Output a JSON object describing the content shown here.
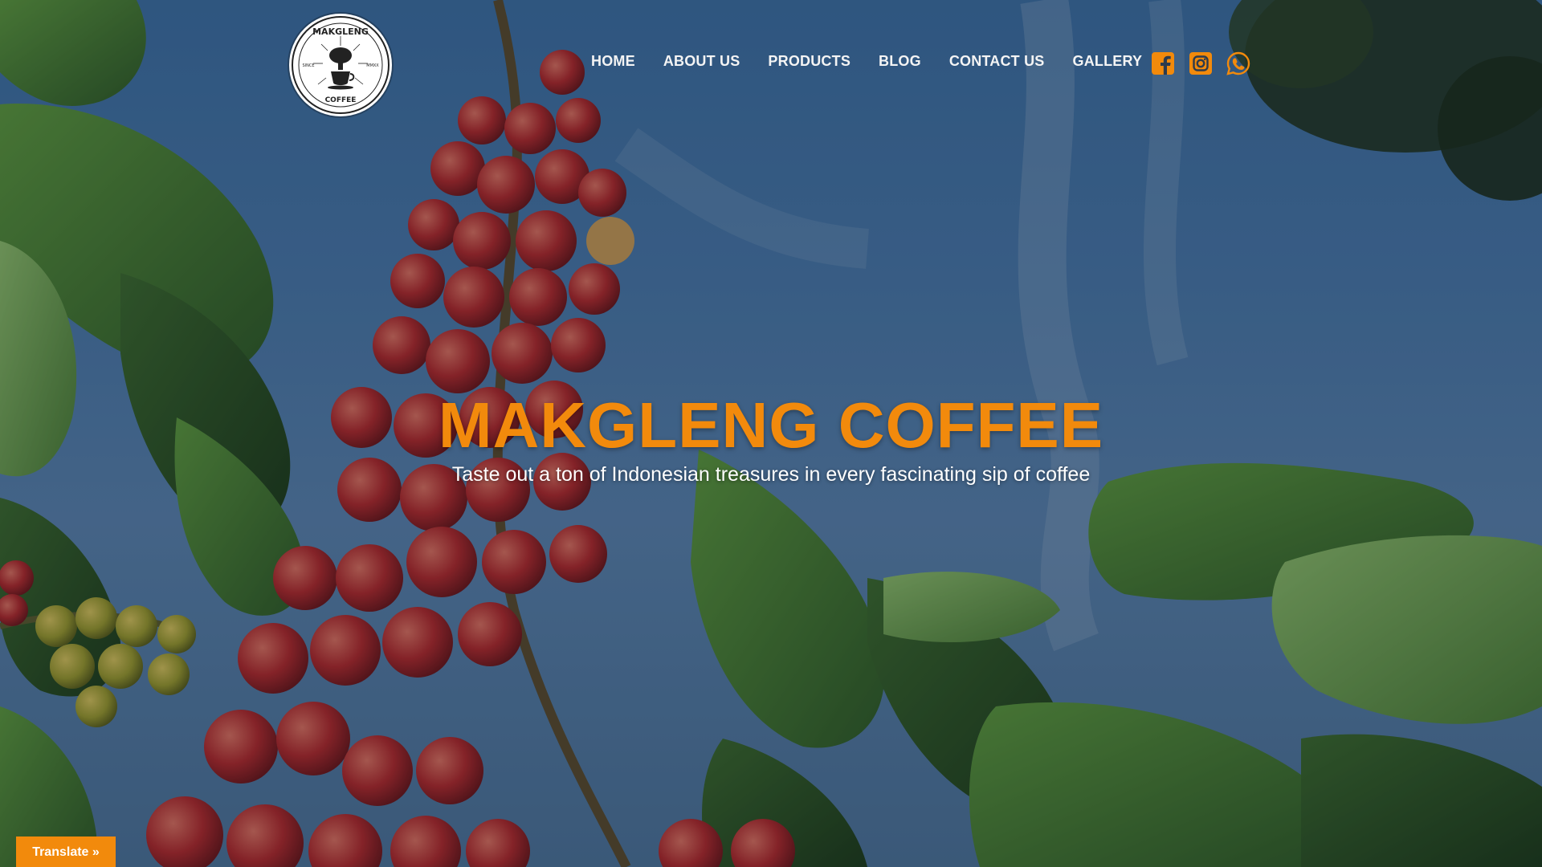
{
  "brand": {
    "logo_text_top": "MAKGLENG",
    "logo_text_bottom": "COFFEE",
    "logo_left": "SINCE",
    "logo_right": "MMXX"
  },
  "nav": {
    "items": [
      {
        "label": "HOME"
      },
      {
        "label": "ABOUT US"
      },
      {
        "label": "PRODUCTS"
      },
      {
        "label": "BLOG"
      },
      {
        "label": "CONTACT US"
      },
      {
        "label": "GALLERY"
      }
    ]
  },
  "social": {
    "icons": [
      "facebook-icon",
      "instagram-icon",
      "whatsapp-icon"
    ],
    "color": "#f28a0c"
  },
  "hero": {
    "title": "MAKGLENG COFFEE",
    "subtitle": "Taste out a ton of Indonesian treasures in every fascinating sip of coffee"
  },
  "translate": {
    "label": "Translate »"
  },
  "colors": {
    "accent": "#f28a0c",
    "nav_text": "#f4f4f4",
    "sky": "#4b79aa"
  }
}
